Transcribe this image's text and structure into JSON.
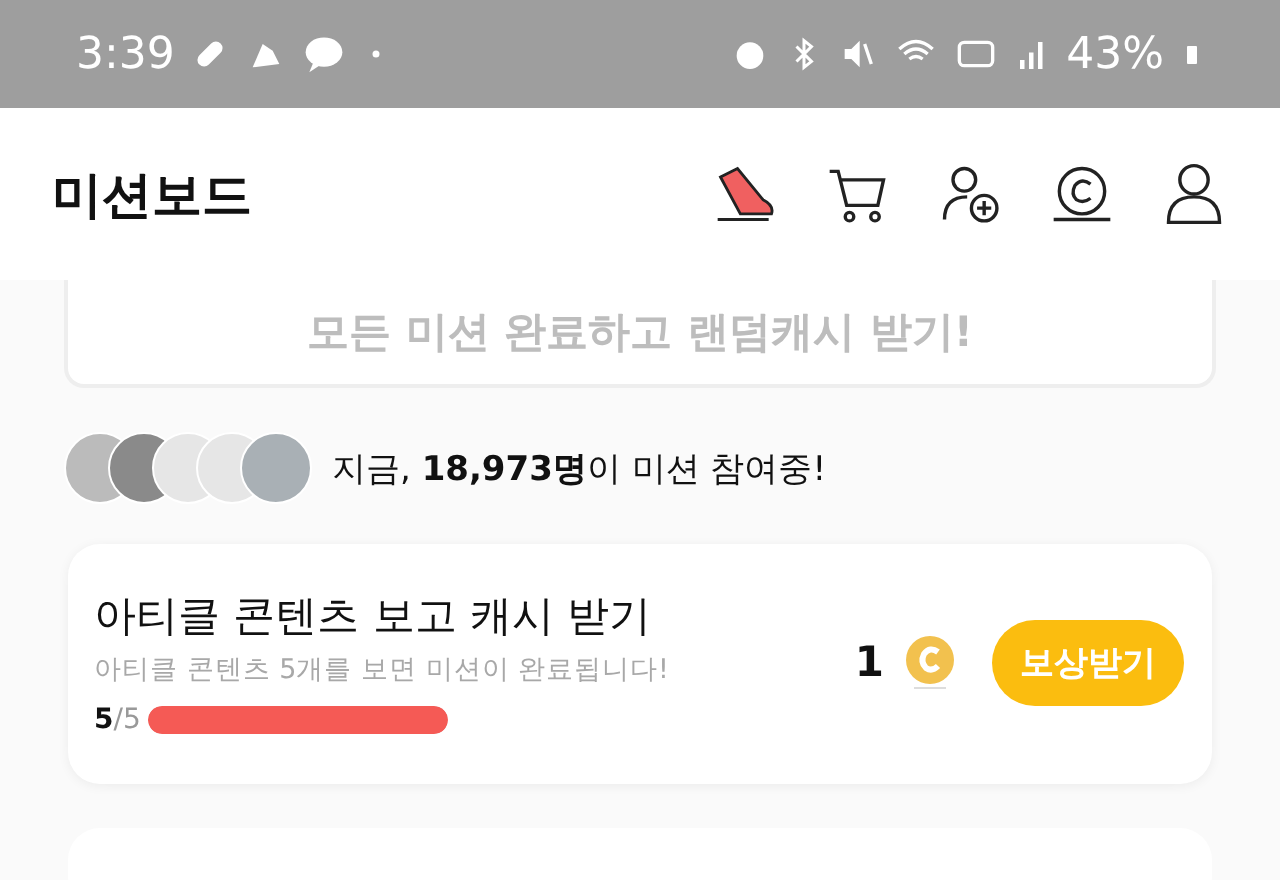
{
  "status_bar": {
    "time": "3:39",
    "battery": "43%"
  },
  "header": {
    "title": "미션보드"
  },
  "banner": {
    "text": "모든 미션 완료하고 랜덤캐시 받기!"
  },
  "participants": {
    "prefix": "지금, ",
    "count": "18,973명",
    "suffix": "이 미션 참여중!"
  },
  "missions": [
    {
      "title": "아티클 콘텐츠 보고 캐시 받기",
      "description": "아티클 콘텐츠 5개를 보면 미션이 완료됩니다!",
      "done": "5",
      "total": "/5",
      "level": 1,
      "reward": "1",
      "button": "보상받기"
    }
  ]
}
